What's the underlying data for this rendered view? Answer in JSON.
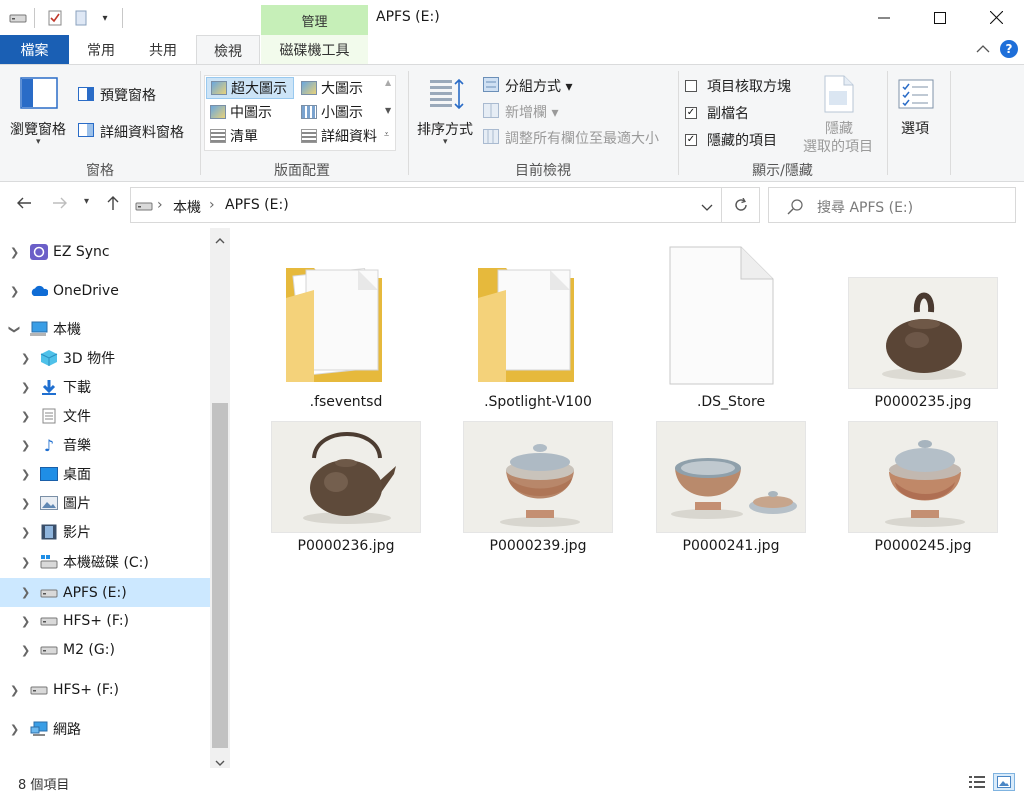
{
  "window": {
    "title": "APFS (E:)",
    "context_tab": "管理",
    "minimize_icon": "minimize-icon",
    "maximize_icon": "maximize-icon",
    "close_icon": "close-icon"
  },
  "tabs": [
    {
      "label": "檔案"
    },
    {
      "label": "常用"
    },
    {
      "label": "共用"
    },
    {
      "label": "檢視"
    },
    {
      "label": "磁碟機工具"
    }
  ],
  "ribbon": {
    "panes": {
      "label": "窗格",
      "navigation_pane": "瀏覽窗格",
      "preview_pane": "預覽窗格",
      "details_pane": "詳細資料窗格"
    },
    "layout": {
      "label": "版面配置",
      "items": [
        "超大圖示",
        "大圖示",
        "中圖示",
        "小圖示",
        "清單",
        "詳細資料"
      ],
      "selected": "超大圖示"
    },
    "current_view": {
      "label": "目前檢視",
      "sort_by": "排序方式",
      "group_by": "分組方式",
      "add_columns": "新增欄",
      "size_all_columns": "調整所有欄位至最適大小"
    },
    "show_hide": {
      "label": "顯示/隱藏",
      "item_checkboxes": {
        "label": "項目核取方塊",
        "checked": false
      },
      "file_extensions": {
        "label": "副檔名",
        "checked": true
      },
      "hidden_items": {
        "label": "隱藏的項目",
        "checked": true
      },
      "hide_selected_line1": "隱藏",
      "hide_selected_line2": "選取的項目"
    },
    "options": {
      "label": "選項"
    }
  },
  "address": {
    "crumbs": [
      "本機",
      "APFS (E:)"
    ],
    "search_placeholder": "搜尋 APFS (E:)"
  },
  "nav_tree": [
    {
      "label": "EZ Sync",
      "icon": "ez-sync-icon"
    },
    {
      "label": "OneDrive",
      "icon": "onedrive-icon"
    },
    {
      "label": "本機",
      "icon": "this-pc-icon"
    },
    {
      "label": "3D 物件",
      "icon": "3d-objects-icon"
    },
    {
      "label": "下載",
      "icon": "downloads-icon"
    },
    {
      "label": "文件",
      "icon": "documents-icon"
    },
    {
      "label": "音樂",
      "icon": "music-icon"
    },
    {
      "label": "桌面",
      "icon": "desktop-icon"
    },
    {
      "label": "圖片",
      "icon": "pictures-icon"
    },
    {
      "label": "影片",
      "icon": "videos-icon"
    },
    {
      "label": "本機磁碟 (C:)",
      "icon": "windows-drive-icon"
    },
    {
      "label": "APFS (E:)",
      "icon": "drive-icon",
      "selected": true
    },
    {
      "label": "HFS+ (F:)",
      "icon": "drive-icon"
    },
    {
      "label": "M2 (G:)",
      "icon": "drive-icon"
    },
    {
      "label": "HFS+ (F:)",
      "icon": "drive-icon"
    },
    {
      "label": "網路",
      "icon": "network-icon"
    }
  ],
  "files": [
    {
      "name": ".fseventsd",
      "type": "folder"
    },
    {
      "name": ".Spotlight-V100",
      "type": "folder"
    },
    {
      "name": ".DS_Store",
      "type": "file"
    },
    {
      "name": "P0000235.jpg",
      "type": "image",
      "subject": "teapot-tall-handle"
    },
    {
      "name": "P0000236.jpg",
      "type": "image",
      "subject": "teapot"
    },
    {
      "name": "P0000239.jpg",
      "type": "image",
      "subject": "gaiwan"
    },
    {
      "name": "P0000241.jpg",
      "type": "image",
      "subject": "gaiwan-lid-off"
    },
    {
      "name": "P0000245.jpg",
      "type": "image",
      "subject": "gaiwan"
    }
  ],
  "status": {
    "item_count": "8 個項目"
  }
}
